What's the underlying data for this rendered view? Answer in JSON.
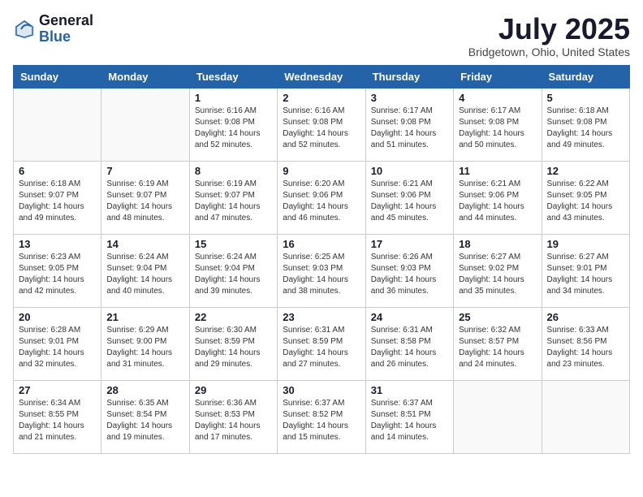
{
  "header": {
    "logo_general": "General",
    "logo_blue": "Blue",
    "month_title": "July 2025",
    "location": "Bridgetown, Ohio, United States"
  },
  "days_of_week": [
    "Sunday",
    "Monday",
    "Tuesday",
    "Wednesday",
    "Thursday",
    "Friday",
    "Saturday"
  ],
  "weeks": [
    [
      {
        "day": "",
        "info": ""
      },
      {
        "day": "",
        "info": ""
      },
      {
        "day": "1",
        "info": "Sunrise: 6:16 AM\nSunset: 9:08 PM\nDaylight: 14 hours and 52 minutes."
      },
      {
        "day": "2",
        "info": "Sunrise: 6:16 AM\nSunset: 9:08 PM\nDaylight: 14 hours and 52 minutes."
      },
      {
        "day": "3",
        "info": "Sunrise: 6:17 AM\nSunset: 9:08 PM\nDaylight: 14 hours and 51 minutes."
      },
      {
        "day": "4",
        "info": "Sunrise: 6:17 AM\nSunset: 9:08 PM\nDaylight: 14 hours and 50 minutes."
      },
      {
        "day": "5",
        "info": "Sunrise: 6:18 AM\nSunset: 9:08 PM\nDaylight: 14 hours and 49 minutes."
      }
    ],
    [
      {
        "day": "6",
        "info": "Sunrise: 6:18 AM\nSunset: 9:07 PM\nDaylight: 14 hours and 49 minutes."
      },
      {
        "day": "7",
        "info": "Sunrise: 6:19 AM\nSunset: 9:07 PM\nDaylight: 14 hours and 48 minutes."
      },
      {
        "day": "8",
        "info": "Sunrise: 6:19 AM\nSunset: 9:07 PM\nDaylight: 14 hours and 47 minutes."
      },
      {
        "day": "9",
        "info": "Sunrise: 6:20 AM\nSunset: 9:06 PM\nDaylight: 14 hours and 46 minutes."
      },
      {
        "day": "10",
        "info": "Sunrise: 6:21 AM\nSunset: 9:06 PM\nDaylight: 14 hours and 45 minutes."
      },
      {
        "day": "11",
        "info": "Sunrise: 6:21 AM\nSunset: 9:06 PM\nDaylight: 14 hours and 44 minutes."
      },
      {
        "day": "12",
        "info": "Sunrise: 6:22 AM\nSunset: 9:05 PM\nDaylight: 14 hours and 43 minutes."
      }
    ],
    [
      {
        "day": "13",
        "info": "Sunrise: 6:23 AM\nSunset: 9:05 PM\nDaylight: 14 hours and 42 minutes."
      },
      {
        "day": "14",
        "info": "Sunrise: 6:24 AM\nSunset: 9:04 PM\nDaylight: 14 hours and 40 minutes."
      },
      {
        "day": "15",
        "info": "Sunrise: 6:24 AM\nSunset: 9:04 PM\nDaylight: 14 hours and 39 minutes."
      },
      {
        "day": "16",
        "info": "Sunrise: 6:25 AM\nSunset: 9:03 PM\nDaylight: 14 hours and 38 minutes."
      },
      {
        "day": "17",
        "info": "Sunrise: 6:26 AM\nSunset: 9:03 PM\nDaylight: 14 hours and 36 minutes."
      },
      {
        "day": "18",
        "info": "Sunrise: 6:27 AM\nSunset: 9:02 PM\nDaylight: 14 hours and 35 minutes."
      },
      {
        "day": "19",
        "info": "Sunrise: 6:27 AM\nSunset: 9:01 PM\nDaylight: 14 hours and 34 minutes."
      }
    ],
    [
      {
        "day": "20",
        "info": "Sunrise: 6:28 AM\nSunset: 9:01 PM\nDaylight: 14 hours and 32 minutes."
      },
      {
        "day": "21",
        "info": "Sunrise: 6:29 AM\nSunset: 9:00 PM\nDaylight: 14 hours and 31 minutes."
      },
      {
        "day": "22",
        "info": "Sunrise: 6:30 AM\nSunset: 8:59 PM\nDaylight: 14 hours and 29 minutes."
      },
      {
        "day": "23",
        "info": "Sunrise: 6:31 AM\nSunset: 8:59 PM\nDaylight: 14 hours and 27 minutes."
      },
      {
        "day": "24",
        "info": "Sunrise: 6:31 AM\nSunset: 8:58 PM\nDaylight: 14 hours and 26 minutes."
      },
      {
        "day": "25",
        "info": "Sunrise: 6:32 AM\nSunset: 8:57 PM\nDaylight: 14 hours and 24 minutes."
      },
      {
        "day": "26",
        "info": "Sunrise: 6:33 AM\nSunset: 8:56 PM\nDaylight: 14 hours and 23 minutes."
      }
    ],
    [
      {
        "day": "27",
        "info": "Sunrise: 6:34 AM\nSunset: 8:55 PM\nDaylight: 14 hours and 21 minutes."
      },
      {
        "day": "28",
        "info": "Sunrise: 6:35 AM\nSunset: 8:54 PM\nDaylight: 14 hours and 19 minutes."
      },
      {
        "day": "29",
        "info": "Sunrise: 6:36 AM\nSunset: 8:53 PM\nDaylight: 14 hours and 17 minutes."
      },
      {
        "day": "30",
        "info": "Sunrise: 6:37 AM\nSunset: 8:52 PM\nDaylight: 14 hours and 15 minutes."
      },
      {
        "day": "31",
        "info": "Sunrise: 6:37 AM\nSunset: 8:51 PM\nDaylight: 14 hours and 14 minutes."
      },
      {
        "day": "",
        "info": ""
      },
      {
        "day": "",
        "info": ""
      }
    ]
  ]
}
